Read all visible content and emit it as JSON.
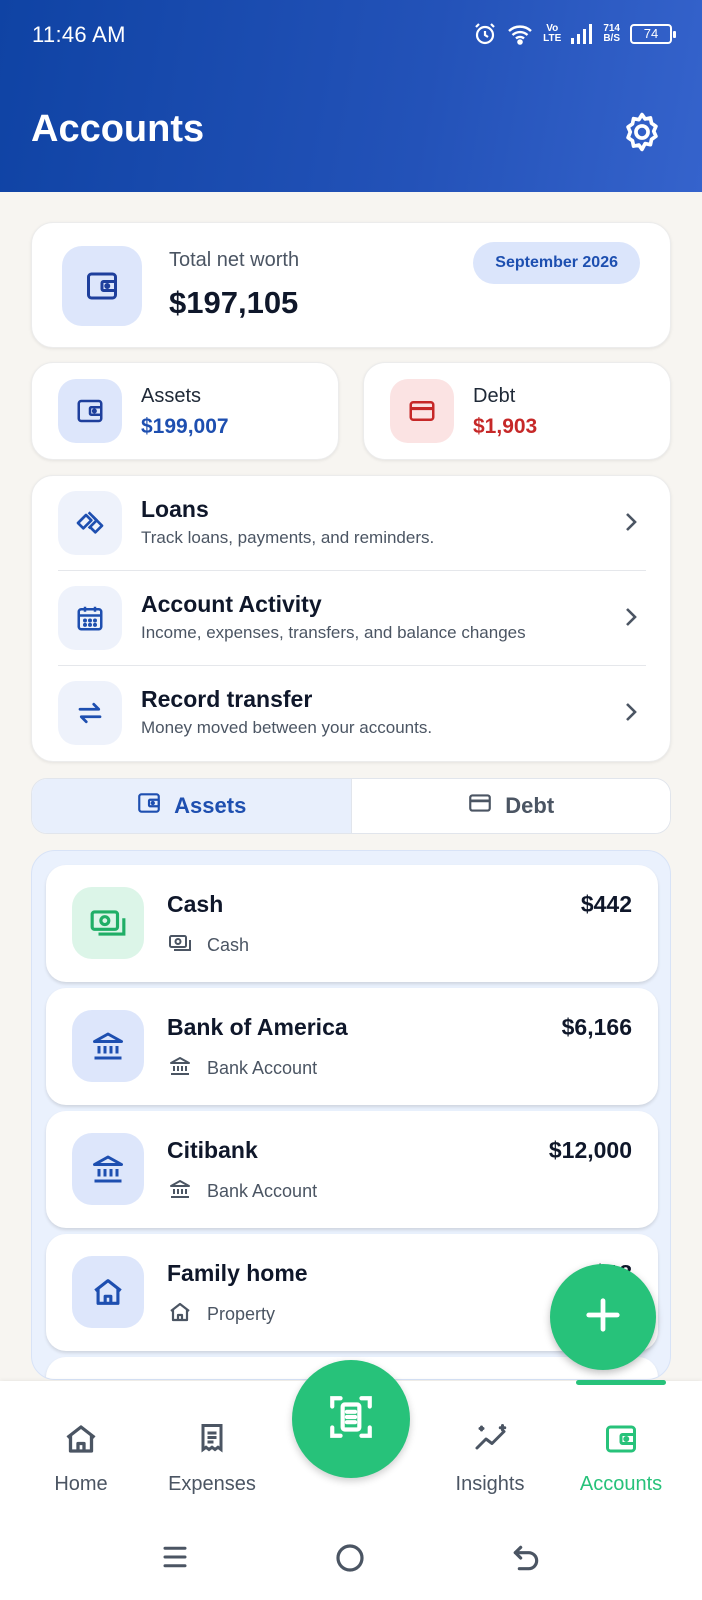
{
  "status_bar": {
    "time": "11:46 AM",
    "net_speed_value": "714",
    "net_speed_unit": "B/S",
    "volte_top": "Vo",
    "volte_bottom": "LTE",
    "battery": "74"
  },
  "header": {
    "title": "Accounts",
    "settings_icon": "gear-icon"
  },
  "net_worth": {
    "label": "Total net worth",
    "value": "$197,105",
    "month_badge": "September 2026",
    "icon": "wallet-icon"
  },
  "summary": {
    "assets": {
      "label": "Assets",
      "value": "$199,007",
      "color": "#1e4fb0",
      "icon": "wallet-icon"
    },
    "debt": {
      "label": "Debt",
      "value": "$1,903",
      "color": "#c62828",
      "icon": "credit-card-icon"
    }
  },
  "menu": [
    {
      "title": "Loans",
      "subtitle": "Track loans, payments, and reminders.",
      "icon": "handshake-icon"
    },
    {
      "title": "Account Activity",
      "subtitle": "Income, expenses, transfers, and balance changes",
      "icon": "calendar-icon"
    },
    {
      "title": "Record transfer",
      "subtitle": "Money moved between your accounts.",
      "icon": "transfer-arrows-icon"
    }
  ],
  "tabs": {
    "assets": "Assets",
    "debt": "Debt",
    "active": "Assets"
  },
  "accounts": [
    {
      "name": "Cash",
      "amount": "$442",
      "type": "Cash",
      "icon": "cash-icon"
    },
    {
      "name": "Bank of America",
      "amount": "$6,166",
      "type": "Bank Account",
      "icon": "bank-icon"
    },
    {
      "name": "Citibank",
      "amount": "$12,000",
      "type": "Bank Account",
      "icon": "bank-icon"
    },
    {
      "name": "Family home",
      "amount": "$18",
      "type": "Property",
      "icon": "house-icon"
    }
  ],
  "bottom_nav": {
    "home": "Home",
    "expenses": "Expenses",
    "insights": "Insights",
    "accounts": "Accounts",
    "active": "Accounts"
  },
  "colors": {
    "header_blue": "#1a4bb0",
    "accent_green": "#27c27a",
    "assets_blue": "#1e4fb0",
    "debt_red": "#c62828"
  }
}
